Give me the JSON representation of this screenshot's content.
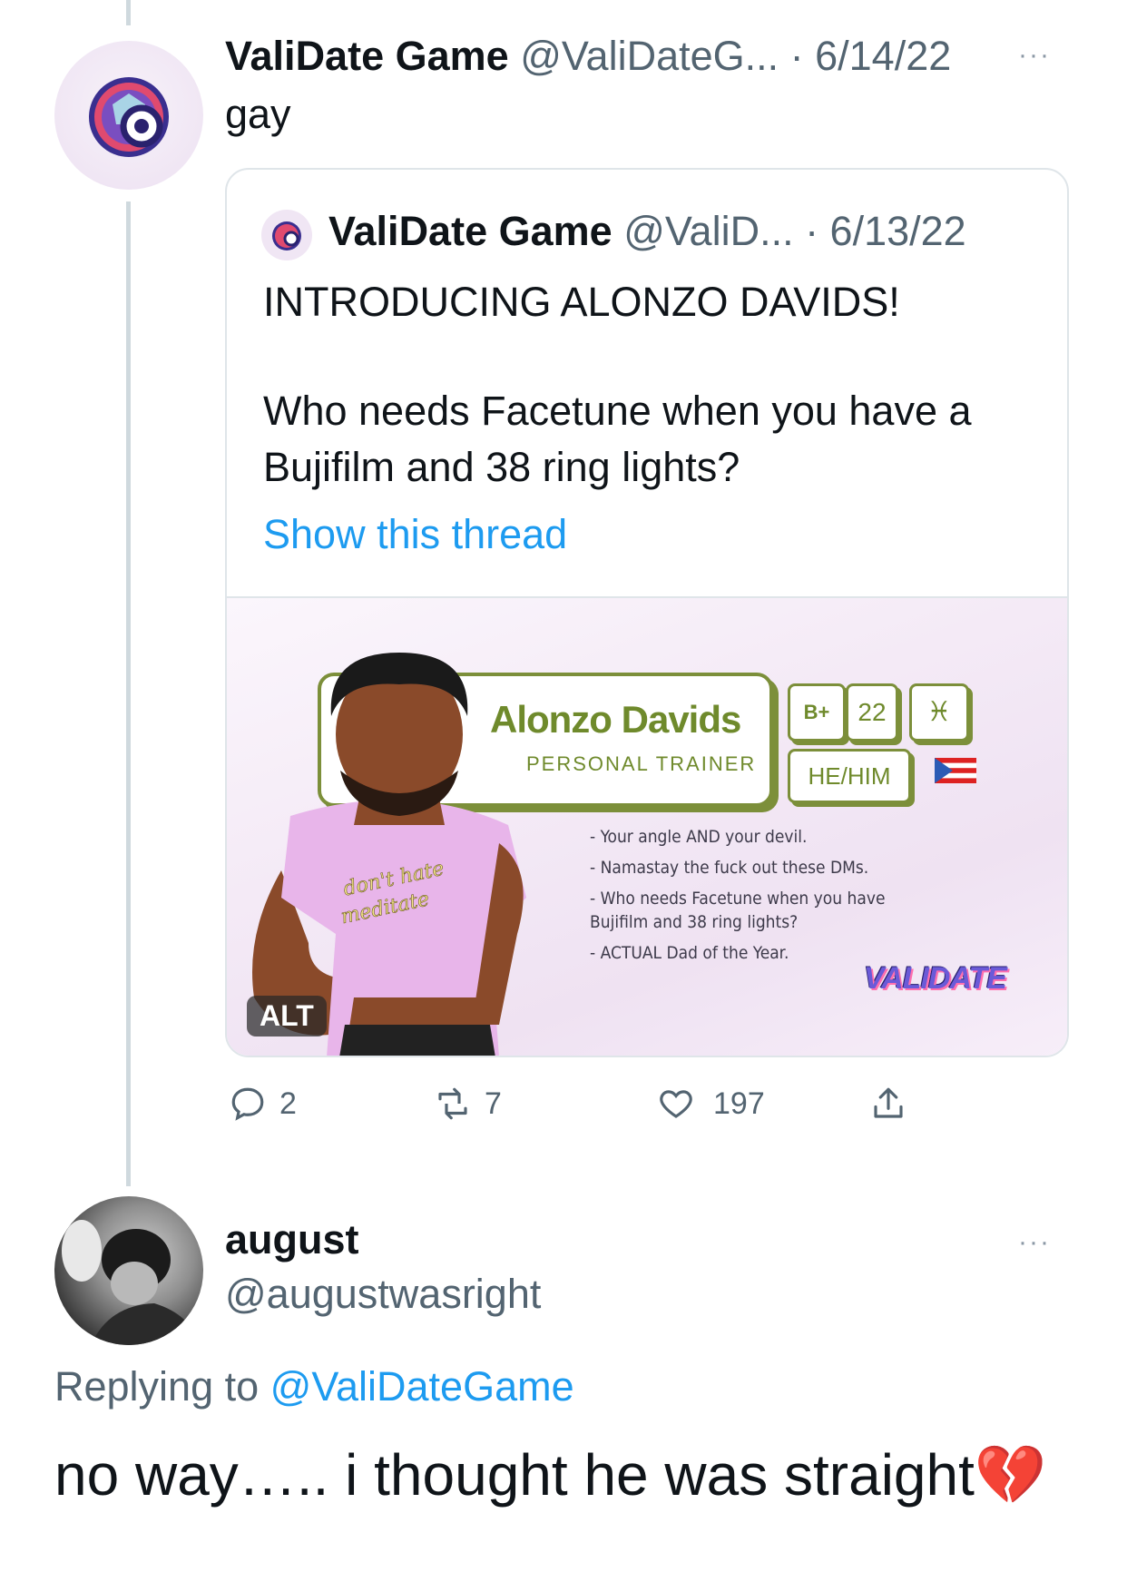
{
  "tweet": {
    "author_name": "ValiDate Game",
    "handle_date": "@ValiDateG... · 6/14/22",
    "text": "gay",
    "more": "···"
  },
  "quote": {
    "author_name": "ValiDate Game",
    "handle_date": "@ValiD... · 6/13/22",
    "line1": "INTRODUCING ALONZO DAVIDS!",
    "line2": "Who needs Facetune when you have a",
    "line3": "Bujifilm and 38 ring lights?",
    "show_thread": "Show this thread"
  },
  "media": {
    "character_name": "Alonzo Davids",
    "occupation": "PERSONAL TRAINER",
    "age": "22",
    "zodiac": "♓",
    "blood_badge": "B+",
    "pronouns": "HE/HIM",
    "shirt_text_1": "don't hate",
    "shirt_text_2": "meditate",
    "bullets": [
      "- Your angle AND your devil.",
      "- Namastay the fuck out these DMs.",
      "- Who needs Facetune when you have",
      "Bujifilm and 38 ring lights?",
      "- ACTUAL Dad of the Year."
    ],
    "logo": "VALIDATE",
    "alt_badge": "ALT"
  },
  "actions": {
    "replies": "2",
    "retweets": "7",
    "likes": "197"
  },
  "reply": {
    "author_name": "august",
    "handle": "@augustwasright",
    "replying_prefix": "Replying to",
    "replying_to": "@ValiDateGame",
    "text": "no way….. i thought he was straight",
    "emoji": "💔",
    "more": "···"
  },
  "colors": {
    "accent_blue": "#1d9bf0",
    "card_green": "#7c8f3a",
    "muted": "#536471"
  }
}
